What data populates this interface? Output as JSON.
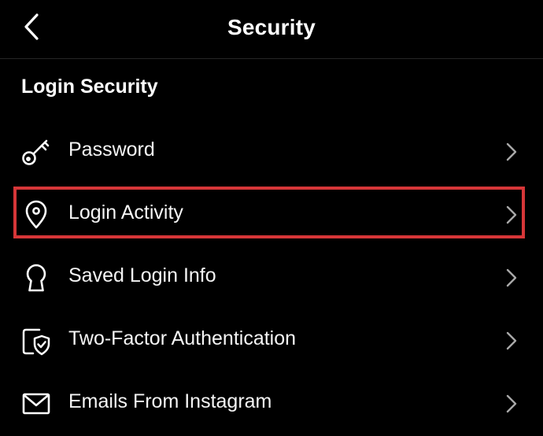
{
  "header": {
    "title": "Security",
    "back_icon": "chevron-left-icon"
  },
  "section": {
    "title": "Login Security"
  },
  "items": [
    {
      "label": "Password",
      "icon": "key-icon"
    },
    {
      "label": "Login Activity",
      "icon": "location-pin-icon"
    },
    {
      "label": "Saved Login Info",
      "icon": "keyhole-icon"
    },
    {
      "label": "Two-Factor Authentication",
      "icon": "shield-check-icon"
    },
    {
      "label": "Emails From Instagram",
      "icon": "envelope-icon"
    }
  ],
  "highlight": {
    "target": "Login Activity",
    "color": "#d63638"
  },
  "colors": {
    "background": "#000000",
    "text": "#ffffff",
    "chevron": "#a8a8a8"
  }
}
